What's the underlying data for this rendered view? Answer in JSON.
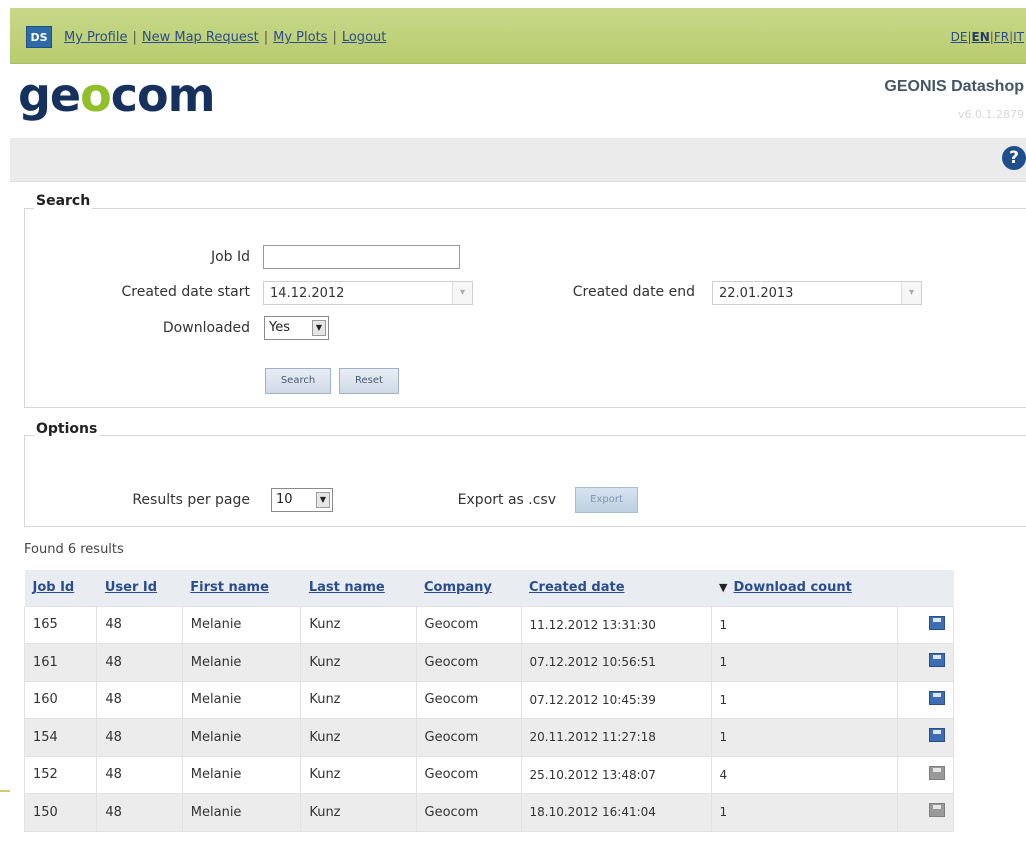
{
  "topbar": {
    "logo_text": "DS",
    "links": [
      "My Profile",
      "New Map Request",
      "My Plots",
      "Logout"
    ],
    "languages": [
      "DE",
      "EN",
      "FR",
      "IT"
    ],
    "current_language": "EN"
  },
  "header": {
    "brand_left": "ge",
    "brand_o": "o",
    "brand_right": "com",
    "product": "GEONIS Datashop",
    "version": "v6.0.1.2879"
  },
  "help": {
    "icon": "help-icon",
    "glyph": "?"
  },
  "search": {
    "legend": "Search",
    "job_id_label": "Job Id",
    "job_id_value": "",
    "created_start_label": "Created date start",
    "created_start_value": "14.12.2012",
    "created_end_label": "Created date end",
    "created_end_value": "22.01.2013",
    "downloaded_label": "Downloaded",
    "downloaded_value": "Yes",
    "search_button": "Search",
    "reset_button": "Reset"
  },
  "options": {
    "legend": "Options",
    "results_per_page_label": "Results per page",
    "results_per_page_value": "10",
    "export_label": "Export as .csv",
    "export_button": "Export"
  },
  "results": {
    "found_text": "Found 6 results",
    "columns": [
      "Job Id",
      "User Id",
      "First name",
      "Last name",
      "Company",
      "Created date",
      "Download count"
    ],
    "sorted_column": "Created date",
    "rows": [
      {
        "job_id": "165",
        "user_id": "48",
        "first": "Melanie",
        "last": "Kunz",
        "company": "Geocom",
        "created": "11.12.2012 13:31:30",
        "downloads": "1",
        "icon": "save-icon-blue"
      },
      {
        "job_id": "161",
        "user_id": "48",
        "first": "Melanie",
        "last": "Kunz",
        "company": "Geocom",
        "created": "07.12.2012 10:56:51",
        "downloads": "1",
        "icon": "save-icon-blue"
      },
      {
        "job_id": "160",
        "user_id": "48",
        "first": "Melanie",
        "last": "Kunz",
        "company": "Geocom",
        "created": "07.12.2012 10:45:39",
        "downloads": "1",
        "icon": "save-icon-blue"
      },
      {
        "job_id": "154",
        "user_id": "48",
        "first": "Melanie",
        "last": "Kunz",
        "company": "Geocom",
        "created": "20.11.2012 11:27:18",
        "downloads": "1",
        "icon": "save-icon-blue"
      },
      {
        "job_id": "152",
        "user_id": "48",
        "first": "Melanie",
        "last": "Kunz",
        "company": "Geocom",
        "created": "25.10.2012 13:48:07",
        "downloads": "4",
        "icon": "save-icon-grey"
      },
      {
        "job_id": "150",
        "user_id": "48",
        "first": "Melanie",
        "last": "Kunz",
        "company": "Geocom",
        "created": "18.10.2012 16:41:04",
        "downloads": "1",
        "icon": "save-icon-grey"
      }
    ]
  },
  "colors": {
    "topbar": "#c8d88a",
    "brand": "#16315e",
    "brand_accent": "#8fbf2a",
    "link": "#2a4d8f"
  }
}
